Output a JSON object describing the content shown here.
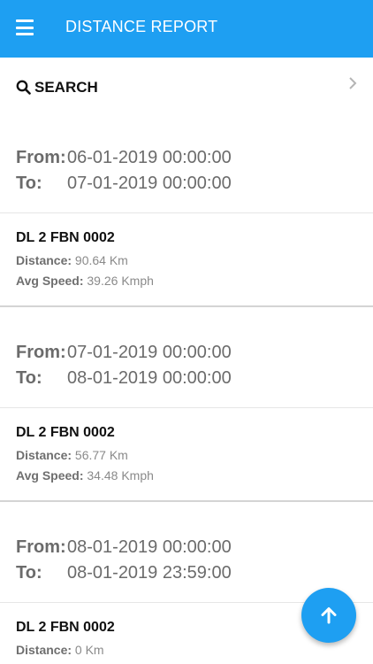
{
  "header": {
    "title": "DISTANCE REPORT",
    "menu_icon": "hamburger-menu-icon",
    "color": "#1e9ff2"
  },
  "search": {
    "label": "SEARCH",
    "icon": "search-icon",
    "chevron_icon": "chevron-right-icon"
  },
  "reports": [
    {
      "from_label": "From:",
      "from": "06-01-2019 00:00:00",
      "to_label": "To:",
      "to": "07-01-2019 00:00:00",
      "vehicle": "DL 2 FBN 0002",
      "distance_label": "Distance:",
      "distance": "90.64 Km",
      "speed_label": "Avg Speed:",
      "speed": "39.26 Kmph"
    },
    {
      "from_label": "From:",
      "from": "07-01-2019 00:00:00",
      "to_label": "To:",
      "to": "08-01-2019 00:00:00",
      "vehicle": "DL 2 FBN 0002",
      "distance_label": "Distance:",
      "distance": "56.77 Km",
      "speed_label": "Avg Speed:",
      "speed": "34.48 Kmph"
    },
    {
      "from_label": "From:",
      "from": "08-01-2019 00:00:00",
      "to_label": "To:",
      "to": "08-01-2019 23:59:00",
      "vehicle": "DL 2 FBN 0002",
      "distance_label": "Distance:",
      "distance": "0 Km"
    }
  ],
  "fab": {
    "icon": "arrow-up-icon",
    "color": "#1e9ff2"
  }
}
